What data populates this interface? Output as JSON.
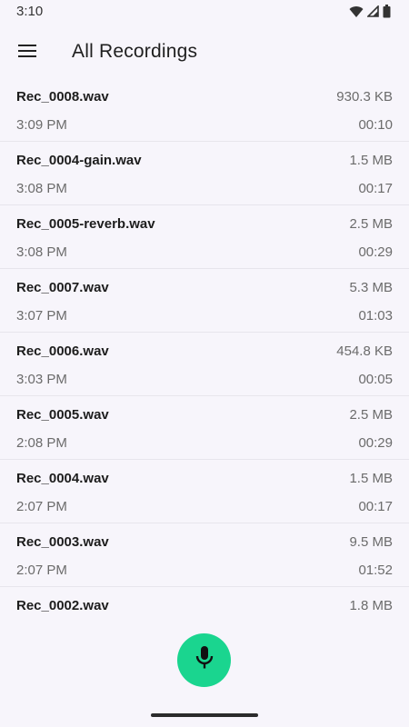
{
  "status_bar": {
    "time": "3:10",
    "icons": [
      "wifi-icon",
      "signal-icon",
      "battery-icon"
    ]
  },
  "app_bar": {
    "menu_icon": "menu-icon",
    "title": "All Recordings"
  },
  "recordings": [
    {
      "name": "Rec_0008.wav",
      "size": "930.3 KB",
      "time": "3:09 PM",
      "duration": "00:10"
    },
    {
      "name": "Rec_0004-gain.wav",
      "size": "1.5 MB",
      "time": "3:08 PM",
      "duration": "00:17"
    },
    {
      "name": "Rec_0005-reverb.wav",
      "size": "2.5 MB",
      "time": "3:08 PM",
      "duration": "00:29"
    },
    {
      "name": "Rec_0007.wav",
      "size": "5.3 MB",
      "time": "3:07 PM",
      "duration": "01:03"
    },
    {
      "name": "Rec_0006.wav",
      "size": "454.8 KB",
      "time": "3:03 PM",
      "duration": "00:05"
    },
    {
      "name": "Rec_0005.wav",
      "size": "2.5 MB",
      "time": "2:08 PM",
      "duration": "00:29"
    },
    {
      "name": "Rec_0004.wav",
      "size": "1.5 MB",
      "time": "2:07 PM",
      "duration": "00:17"
    },
    {
      "name": "Rec_0003.wav",
      "size": "9.5 MB",
      "time": "2:07 PM",
      "duration": "01:52"
    },
    {
      "name": "Rec_0002.wav",
      "size": "1.8 MB",
      "time": "",
      "duration": ""
    }
  ],
  "fab": {
    "icon": "microphone-icon",
    "color": "#1ad58f"
  },
  "colors": {
    "background": "#f7f5fb",
    "accent": "#1ad58f"
  }
}
